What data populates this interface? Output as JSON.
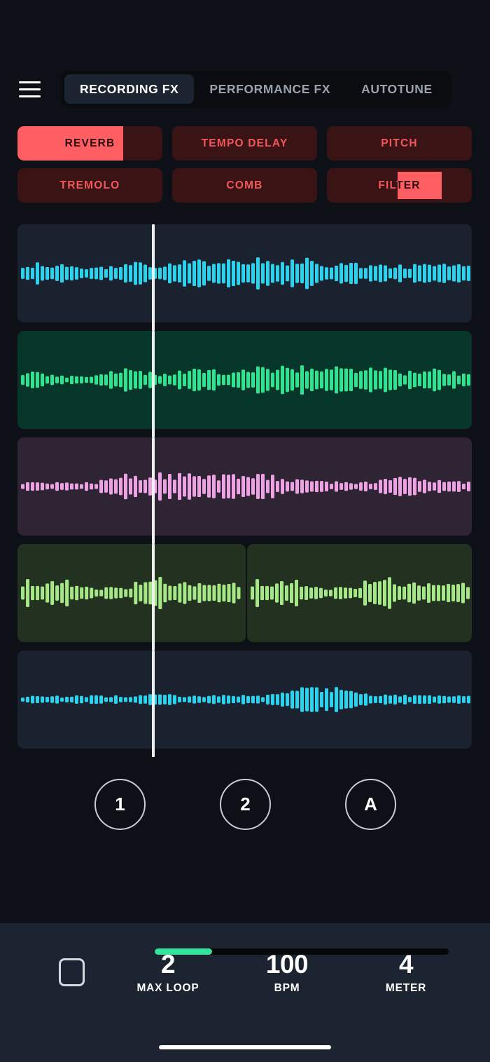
{
  "app": {
    "background": "#0d1117",
    "menu_icon": "hamburger-menu-icon"
  },
  "header": {
    "tabs": [
      {
        "label": "RECORDING FX",
        "active": true
      },
      {
        "label": "PERFORMANCE FX",
        "active": false
      },
      {
        "label": "AUTOTUNE",
        "active": false
      }
    ]
  },
  "fx": {
    "accent_fill": "#ff5e62",
    "accent_text": "#f2575c",
    "panel_bg": "#3a1414",
    "buttons": [
      {
        "label": "REVERB",
        "fill_start_pct": 0,
        "fill_end_pct": 73
      },
      {
        "label": "TEMPO DELAY",
        "fill_start_pct": 0,
        "fill_end_pct": 0
      },
      {
        "label": "PITCH",
        "fill_start_pct": 0,
        "fill_end_pct": 0
      },
      {
        "label": "TREMOLO",
        "fill_start_pct": 0,
        "fill_end_pct": 0
      },
      {
        "label": "COMB",
        "fill_start_pct": 0,
        "fill_end_pct": 0
      },
      {
        "label": "FILTER",
        "fill_start_pct": 49,
        "fill_end_pct": 79
      }
    ]
  },
  "timeline": {
    "playhead_pct": 29.6,
    "playhead_color": "#f0f0f0",
    "tracks": [
      {
        "name": "track-1",
        "wave_color": "#2ad4ef",
        "panel_bg": "#1a2230",
        "clips": [
          {
            "start_pct": 0,
            "end_pct": 100,
            "seed": 11,
            "density": 0.72,
            "envelope": [
              0.62,
              0.5,
              0.28,
              0.66,
              0.44,
              0.82,
              0.74,
              0.9,
              0.86,
              0.6,
              0.52,
              0.48,
              0.56,
              0.44
            ]
          }
        ]
      },
      {
        "name": "track-2",
        "wave_color": "#2fe391",
        "panel_bg": "#06352a",
        "clips": [
          {
            "start_pct": 0,
            "end_pct": 100,
            "seed": 27,
            "density": 0.7,
            "envelope": [
              0.56,
              0.26,
              0.22,
              0.7,
              0.4,
              0.66,
              0.52,
              0.78,
              0.82,
              0.8,
              0.78,
              0.52,
              0.72,
              0.34
            ]
          }
        ]
      },
      {
        "name": "track-3",
        "wave_color": "#eda2e4",
        "panel_bg": "#2e2434",
        "clips": [
          {
            "start_pct": 0,
            "end_pct": 100,
            "seed": 41,
            "density": 0.66,
            "envelope": [
              0.3,
              0.26,
              0.24,
              0.74,
              0.8,
              0.76,
              0.72,
              0.8,
              0.44,
              0.3,
              0.28,
              0.66,
              0.4,
              0.26
            ]
          }
        ]
      },
      {
        "name": "track-4",
        "wave_color": "#a6e887",
        "panel_bg": "#233120",
        "clips": [
          {
            "start_pct": 0,
            "end_pct": 50.2,
            "seed": 63,
            "density": 0.8,
            "envelope": [
              0.66,
              0.62,
              0.64,
              0.6,
              0.34,
              0.3,
              0.34,
              0.72,
              0.84,
              0.6,
              0.52,
              0.5,
              0.48,
              0.46
            ]
          },
          {
            "start_pct": 50.5,
            "end_pct": 100,
            "seed": 63,
            "density": 0.8,
            "envelope": [
              0.66,
              0.62,
              0.64,
              0.6,
              0.34,
              0.3,
              0.34,
              0.72,
              0.84,
              0.6,
              0.52,
              0.5,
              0.48,
              0.46
            ]
          }
        ]
      },
      {
        "name": "track-5",
        "wave_color": "#2ad4ef",
        "panel_bg": "#1a2230",
        "clips": [
          {
            "start_pct": 0,
            "end_pct": 100,
            "seed": 89,
            "density": 0.62,
            "envelope": [
              0.26,
              0.24,
              0.26,
              0.3,
              0.34,
              0.3,
              0.28,
              0.3,
              0.8,
              0.78,
              0.4,
              0.3,
              0.26,
              0.24
            ]
          }
        ]
      }
    ]
  },
  "loops": {
    "buttons": [
      {
        "label": "1"
      },
      {
        "label": "2"
      },
      {
        "label": "A"
      }
    ]
  },
  "transport": {
    "stop_icon": "stop-square-icon",
    "progress_pct": 19.5,
    "progress_color": "#34e39b",
    "stats": [
      {
        "value": "2",
        "label": "MAX LOOP"
      },
      {
        "value": "100",
        "label": "BPM"
      },
      {
        "value": "4",
        "label": "METER"
      }
    ]
  }
}
